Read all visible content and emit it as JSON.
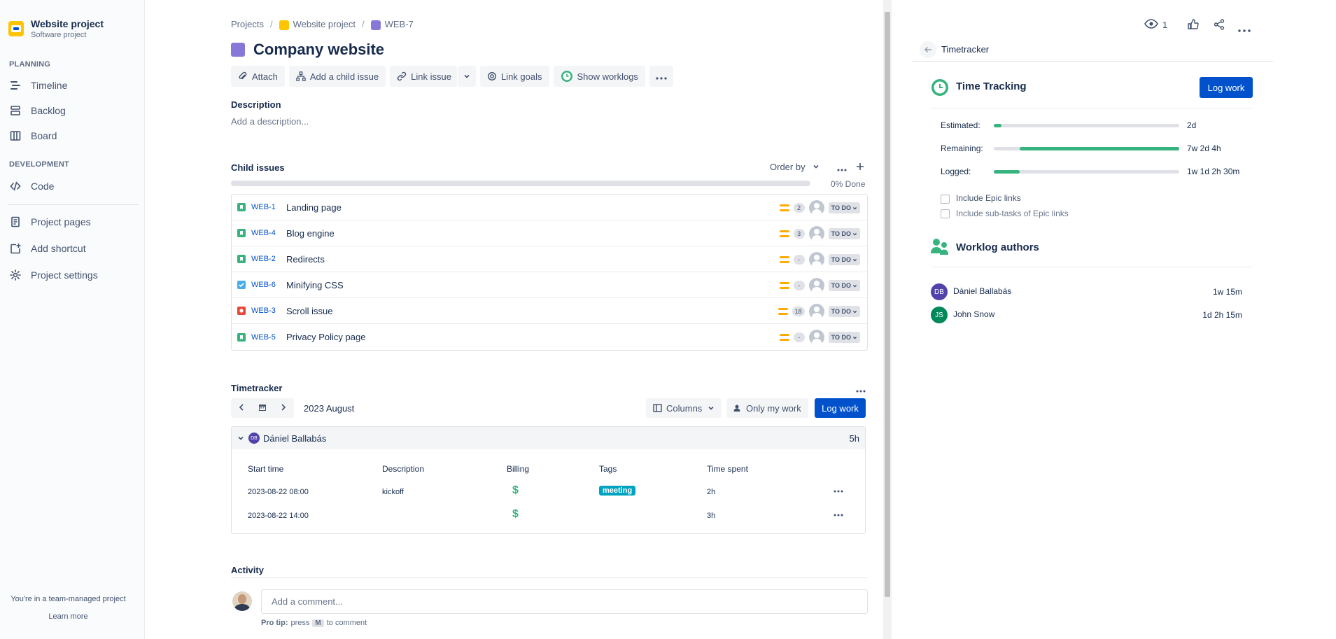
{
  "sidebar": {
    "project_name": "Website project",
    "project_type": "Software project",
    "sections": {
      "planning": "PLANNING",
      "development": "DEVELOPMENT"
    },
    "items": {
      "timeline": "Timeline",
      "backlog": "Backlog",
      "board": "Board",
      "code": "Code",
      "project_pages": "Project pages",
      "add_shortcut": "Add shortcut",
      "project_settings": "Project settings"
    },
    "footer_text": "You're in a team-managed project",
    "learn_more": "Learn more"
  },
  "breadcrumb": {
    "projects": "Projects",
    "project": "Website project",
    "issue_key": "WEB-7",
    "separator": "/"
  },
  "issue": {
    "title": "Company website"
  },
  "toolbar": {
    "attach": "Attach",
    "add_child": "Add a child issue",
    "link_issue": "Link issue",
    "link_goals": "Link goals",
    "show_worklogs": "Show worklogs"
  },
  "description": {
    "label": "Description",
    "placeholder": "Add a description..."
  },
  "child_issues": {
    "label": "Child issues",
    "order_by": "Order by",
    "progress_text": "0% Done",
    "items": [
      {
        "key": "WEB-1",
        "summary": "Landing page",
        "points": "2",
        "status": "TO DO",
        "type": "story"
      },
      {
        "key": "WEB-4",
        "summary": "Blog engine",
        "points": "3",
        "status": "TO DO",
        "type": "story"
      },
      {
        "key": "WEB-2",
        "summary": "Redirects",
        "points": "-",
        "status": "TO DO",
        "type": "story"
      },
      {
        "key": "WEB-6",
        "summary": "Minifying CSS",
        "points": "-",
        "status": "TO DO",
        "type": "task"
      },
      {
        "key": "WEB-3",
        "summary": "Scroll issue",
        "points": "18",
        "status": "TO DO",
        "type": "bug"
      },
      {
        "key": "WEB-5",
        "summary": "Privacy Policy page",
        "points": "-",
        "status": "TO DO",
        "type": "story"
      }
    ]
  },
  "timetracker": {
    "label": "Timetracker",
    "period": "2023 August",
    "columns_btn": "Columns",
    "only_my_work": "Only my work",
    "log_work": "Log work",
    "group": {
      "initials": "DB",
      "name": "Dániel Ballabás",
      "total": "5h"
    },
    "headers": {
      "start": "Start time",
      "description": "Description",
      "billing": "Billing",
      "tags": "Tags",
      "time_spent": "Time spent"
    },
    "rows": [
      {
        "start": "2023-08-22 08:00",
        "description": "kickoff",
        "billing": "$",
        "tag": "meeting",
        "time": "2h"
      },
      {
        "start": "2023-08-22 14:00",
        "description": "",
        "billing": "$",
        "tag": "",
        "time": "3h"
      }
    ]
  },
  "activity": {
    "label": "Activity",
    "comment_placeholder": "Add a comment...",
    "pro_tip_label": "Pro tip:",
    "pro_tip_press": "press",
    "pro_tip_key": "M",
    "pro_tip_tail": "to comment"
  },
  "right_panel": {
    "watchers": "1",
    "back_title": "Timetracker",
    "time_tracking_title": "Time Tracking",
    "log_work": "Log work",
    "estimated_label": "Estimated:",
    "estimated_value": "2d",
    "estimated_fraction": 0.04,
    "remaining_label": "Remaining:",
    "remaining_value": "7w 2d 4h",
    "remaining_fraction": 0.86,
    "logged_label": "Logged:",
    "logged_value": "1w 1d 2h 30m",
    "logged_fraction": 0.14,
    "include_epic": "Include Epic links",
    "include_subtasks": "Include sub-tasks of Epic links",
    "authors_title": "Worklog authors",
    "authors": [
      {
        "initials": "DB",
        "name": "Dániel Ballabás",
        "time": "1w 15m",
        "color": "#5243aa"
      },
      {
        "initials": "JS",
        "name": "John Snow",
        "time": "1d 2h 15m",
        "color": "#00875a"
      }
    ]
  },
  "colors": {
    "brand": "#0052cc",
    "green": "#36b37e",
    "epic": "#8777d9",
    "story": "#36b37e",
    "task": "#4bade8",
    "bug": "#e5493a"
  }
}
